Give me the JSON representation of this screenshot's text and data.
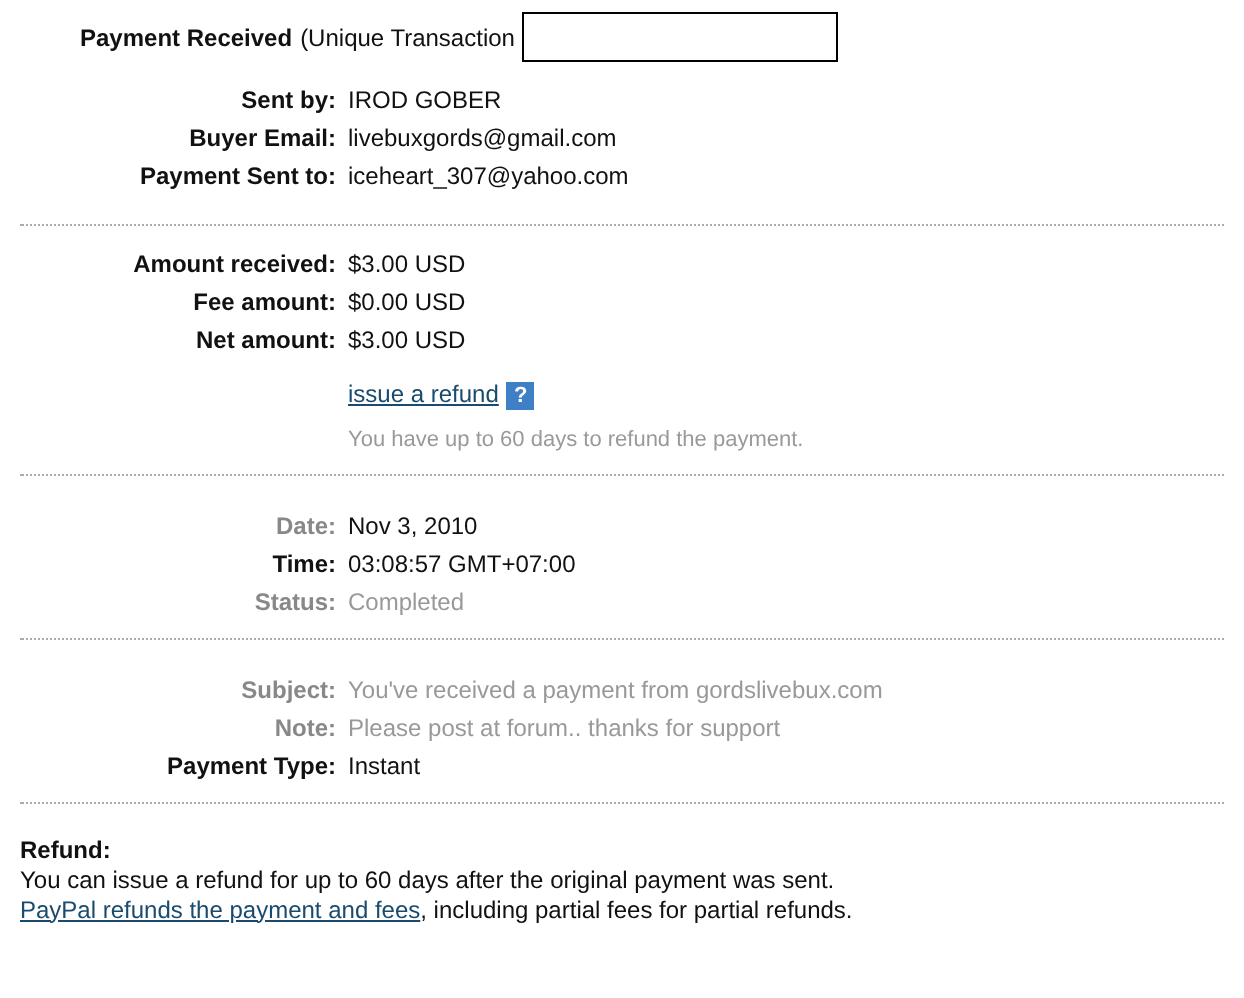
{
  "header": {
    "title": "Payment Received",
    "subtitle": "(Unique Transaction"
  },
  "sections": [
    {
      "rows": [
        {
          "label": "Sent by:",
          "value": "IROD GOBER",
          "label_muted": false,
          "value_muted": false
        },
        {
          "label": "Buyer Email:",
          "value": "livebuxgords@gmail.com",
          "label_muted": false,
          "value_muted": false
        },
        {
          "label": "Payment Sent to:",
          "value": "iceheart_307@yahoo.com",
          "label_muted": false,
          "value_muted": false
        }
      ]
    },
    {
      "rows": [
        {
          "label": "Amount received:",
          "value": "$3.00 USD",
          "label_muted": false,
          "value_muted": false
        },
        {
          "label": "Fee amount:",
          "value": "$0.00 USD",
          "label_muted": false,
          "value_muted": false
        },
        {
          "label": "Net amount:",
          "value": "$3.00 USD",
          "label_muted": false,
          "value_muted": false
        }
      ],
      "refund_link": "issue a refund",
      "refund_help": "?",
      "refund_note": "You have up to 60 days to refund the payment."
    },
    {
      "rows": [
        {
          "label": "Date:",
          "value": "Nov 3, 2010",
          "label_muted": true,
          "value_muted": false
        },
        {
          "label": "Time:",
          "value": "03:08:57 GMT+07:00",
          "label_muted": false,
          "value_muted": false
        },
        {
          "label": "Status:",
          "value": "Completed",
          "label_muted": true,
          "value_muted": true
        }
      ]
    },
    {
      "rows": [
        {
          "label": "Subject:",
          "value": "You've received a payment from gordslivebux.com",
          "label_muted": true,
          "value_muted": true
        },
        {
          "label": "Note:",
          "value": "Please post at forum.. thanks for support",
          "label_muted": true,
          "value_muted": true
        },
        {
          "label": "Payment Type:",
          "value": "Instant",
          "label_muted": false,
          "value_muted": false
        }
      ]
    }
  ],
  "refund": {
    "heading": "Refund:",
    "text_before": "You can issue a refund for up to 60 days after the original payment was sent. ",
    "link": "PayPal refunds the payment and fees",
    "text_after": ", including partial fees for partial refunds."
  }
}
